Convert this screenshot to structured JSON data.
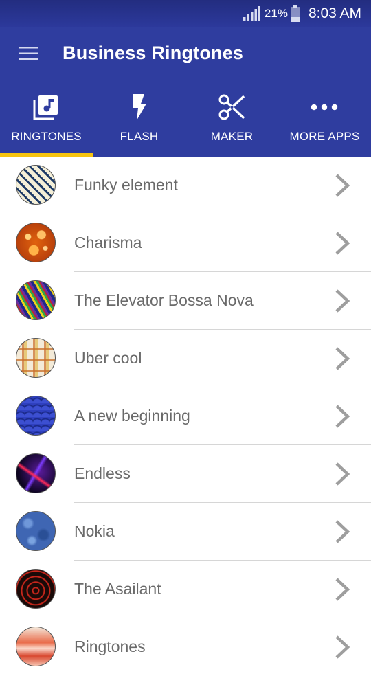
{
  "status_bar": {
    "battery_percent": "21%",
    "time": "8:03 AM",
    "icons": [
      "signal-icon",
      "battery-icon"
    ]
  },
  "app_bar": {
    "title": "Business Ringtones",
    "menu_icon": "hamburger-menu-icon"
  },
  "tabs": [
    {
      "label": "RINGTONES",
      "icon": "music-library-icon",
      "selected": true
    },
    {
      "label": "FLASH",
      "icon": "lightning-bolt-icon",
      "selected": false
    },
    {
      "label": "MAKER",
      "icon": "scissors-icon",
      "selected": false
    },
    {
      "label": "MORE APPS",
      "icon": "more-dots-icon",
      "selected": false
    }
  ],
  "colors": {
    "primary": "#2f3d9f",
    "status_bar": "#232d80",
    "tab_indicator": "#f7c40f",
    "list_text": "#6a6a6a",
    "chevron": "#9e9e9e"
  },
  "ringtones": [
    {
      "name": "Funky element",
      "thumbnail": "diagonal-stripes"
    },
    {
      "name": "Charisma",
      "thumbnail": "orange-bubbles"
    },
    {
      "name": "The Elevator Bossa Nova",
      "thumbnail": "color-streaks"
    },
    {
      "name": "Uber cool",
      "thumbnail": "plaid"
    },
    {
      "name": "A new beginning",
      "thumbnail": "blue-scales"
    },
    {
      "name": "Endless",
      "thumbnail": "neon-lines"
    },
    {
      "name": "Nokia",
      "thumbnail": "blue-texture"
    },
    {
      "name": "The Asailant",
      "thumbnail": "red-swirl"
    },
    {
      "name": "Ringtones",
      "thumbnail": "red-wave"
    }
  ]
}
